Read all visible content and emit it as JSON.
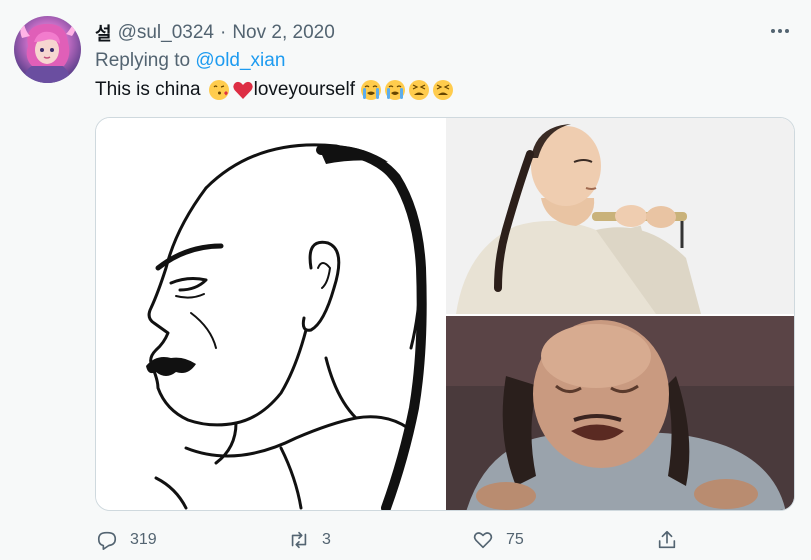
{
  "tweet": {
    "display_name": "설",
    "handle": "@sul_0324",
    "separator": "·",
    "date": "Nov 2, 2020",
    "replying_prefix": "Replying to",
    "replying_to": "@old_xian",
    "text_part1": "This is china",
    "text_part2": "loveyourself",
    "emojis_before": [
      "face-blowing-kiss-icon",
      "red-heart-icon"
    ],
    "emojis_after": [
      "loudly-crying-face-icon",
      "loudly-crying-face-icon",
      "tired-face-icon",
      "tired-face-icon"
    ]
  },
  "media": {
    "images": [
      "line-drawing-of-bald-man-with-queue",
      "man-playing-flute",
      "crying-bald-man"
    ]
  },
  "actions": {
    "reply_count": "319",
    "retweet_count": "3",
    "like_count": "75"
  },
  "colors": {
    "background": "#f7f9f9",
    "text": "#0f1419",
    "secondary": "#536471",
    "link": "#1d9bf0",
    "border": "#cfd9de"
  }
}
